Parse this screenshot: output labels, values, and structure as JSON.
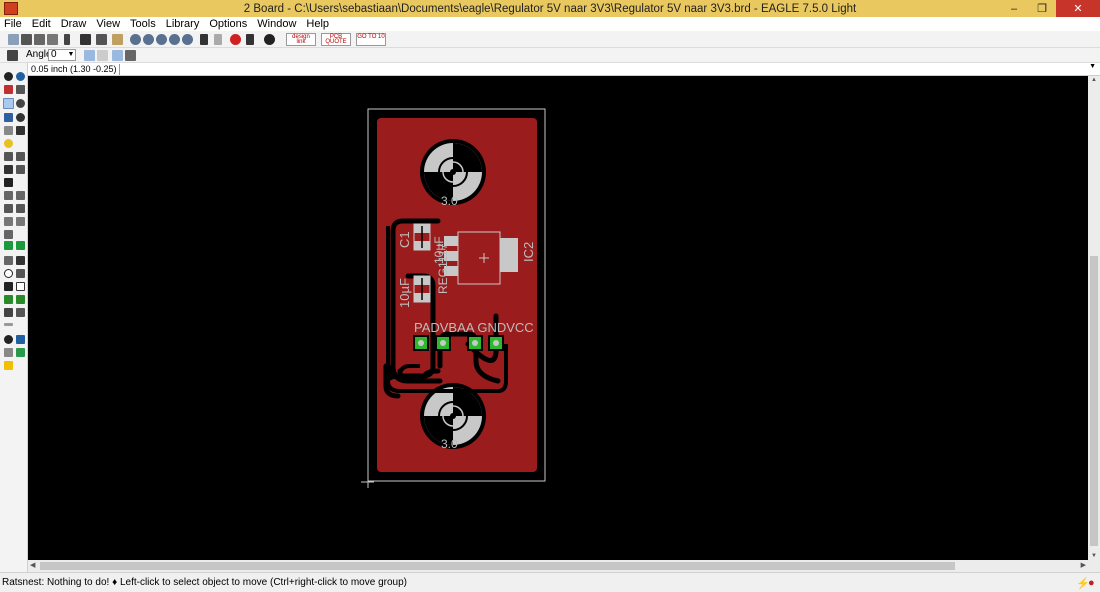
{
  "window": {
    "title": "2 Board - C:\\Users\\sebastiaan\\Documents\\eagle\\Regulator 5V naar 3V3\\Regulator 5V naar 3V3.brd - EAGLE 7.5.0 Light",
    "minimize": "–",
    "maximize": "❐",
    "close": "✕"
  },
  "menu": [
    "File",
    "Edit",
    "Draw",
    "View",
    "Tools",
    "Library",
    "Options",
    "Window",
    "Help"
  ],
  "toolbar": {
    "pill_design_link": "design link",
    "pill_pcb_quote": "PCB QUOTE",
    "pill_go": "GO TO 10"
  },
  "parameter_bar": {
    "angle_label": "Angle:",
    "angle_value": "0"
  },
  "command_line": {
    "coordinate": "0.05 inch (1.30 -0.25)",
    "input_value": ""
  },
  "board": {
    "labels": {
      "c1": "C1",
      "c1_value": "10µF",
      "c2_value": "10µF",
      "reg": "REG1117",
      "ic2": "IC2",
      "hole_top": "3.0",
      "hole_bottom": "3.0",
      "pad_labels": "PADVBAA GNDVCC"
    }
  },
  "colors": {
    "board_fill": "#9b1c1c",
    "trace": "#000000",
    "pad": "#c8c8c8",
    "via_green": "#2db82d",
    "outline": "#c8c8c8",
    "label_text": "#bdbdbd"
  },
  "status": {
    "text": "Ratsnest: Nothing to do!  ♦ Left-click to select object to move (Ctrl+right-click to move group)",
    "lightning": "⚡",
    "stop": "●"
  }
}
